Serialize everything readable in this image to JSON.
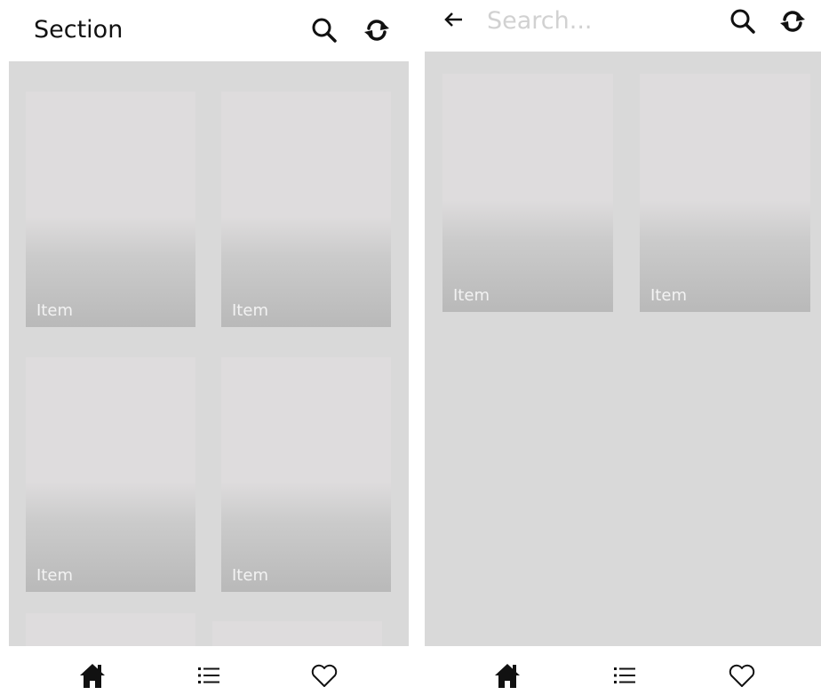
{
  "left_screen": {
    "header": {
      "title": "Section",
      "search_icon": "search-icon",
      "refresh_icon": "refresh-icon"
    },
    "items": [
      {
        "label": "Item"
      },
      {
        "label": "Item"
      },
      {
        "label": "Item"
      },
      {
        "label": "Item"
      },
      {
        "label": ""
      },
      {
        "label": ""
      }
    ]
  },
  "right_screen": {
    "header": {
      "back_icon": "arrow-left-icon",
      "search_placeholder": "Search...",
      "search_value": "",
      "search_icon": "search-icon",
      "refresh_icon": "refresh-icon"
    },
    "items": [
      {
        "label": "Item"
      },
      {
        "label": "Item"
      }
    ]
  },
  "bottom_nav": {
    "items": [
      {
        "icon": "home-icon"
      },
      {
        "icon": "list-icon"
      },
      {
        "icon": "heart-icon"
      }
    ]
  },
  "colors": {
    "content_bg": "#d9d9d9",
    "card_top": "#dedcdd",
    "card_bottom": "#b9b9b9",
    "label": "#f3f3f3",
    "text": "#111111",
    "placeholder": "#d1d1d1"
  }
}
